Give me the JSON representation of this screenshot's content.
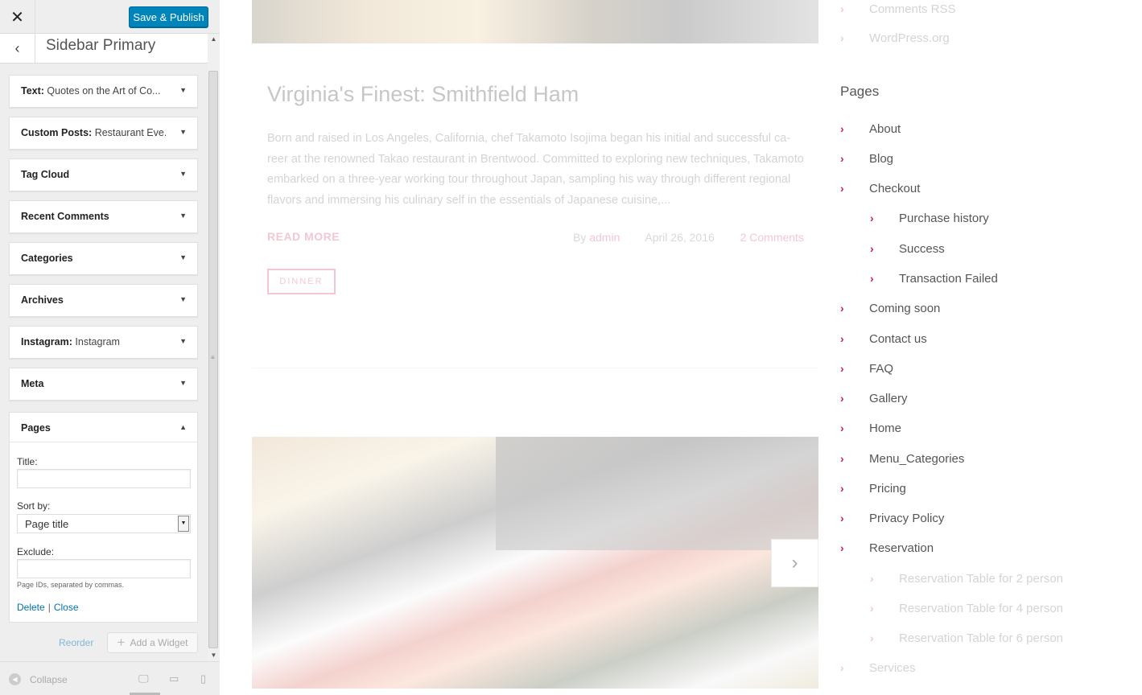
{
  "customizer": {
    "close_icon": "close-icon",
    "publish_label": "Save & Publish",
    "back_icon": "chevron-left-icon",
    "section_title": "Sidebar Primary",
    "widgets": [
      {
        "type": "Text:",
        "name": "Quotes on the Art of Co..."
      },
      {
        "type": "Custom Posts:",
        "name": "Restaurant Eve..."
      },
      {
        "type": "Tag Cloud",
        "name": ""
      },
      {
        "type": "Recent Comments",
        "name": ""
      },
      {
        "type": "Categories",
        "name": ""
      },
      {
        "type": "Archives",
        "name": ""
      },
      {
        "type": "Instagram:",
        "name": "Instagram"
      },
      {
        "type": "Meta",
        "name": ""
      }
    ],
    "pages_widget": {
      "type": "Pages",
      "title_label": "Title:",
      "title_value": "",
      "sort_label": "Sort by:",
      "sort_value": "Page title",
      "exclude_label": "Exclude:",
      "exclude_value": "",
      "help_text": "Page IDs, separated by commas.",
      "delete_label": "Delete",
      "link_sep": "|",
      "close_label": "Close"
    },
    "reorder_label": "Reorder",
    "add_widget_label": "Add a Widget",
    "collapse_label": "Collapse",
    "devices": [
      "desktop-icon",
      "tablet-icon",
      "mobile-icon"
    ],
    "accent_color": "#0085ba"
  },
  "preview": {
    "top_links": [
      "Comments RSS",
      "WordPress.org"
    ],
    "post": {
      "title": "Virginia's Finest: Smithfield Ham",
      "excerpt": "Born and raised in Los Angeles, California, chef Takamoto Isojima began his initial and successful ca-reer at the renowned Takao restaurant in Brentwood. Committed to exploring new techniques, Takamoto embarked on a three-year working tour throughout Japan, sampling his way through different regional flavors and immersing his culinary self in the essentials of Japanese cuisine,...",
      "read_more": "READ MORE",
      "by_label": "By",
      "author": "admin",
      "date": "April 26, 2016",
      "comments": "2 Comments",
      "tag": "DINNER"
    },
    "next_icon": "chevron-right-icon",
    "pages_heading": "Pages",
    "pages": [
      {
        "label": "About",
        "level": 0
      },
      {
        "label": "Blog",
        "level": 0
      },
      {
        "label": "Checkout",
        "level": 0
      },
      {
        "label": "Purchase history",
        "level": 1
      },
      {
        "label": "Success",
        "level": 1
      },
      {
        "label": "Transaction Failed",
        "level": 1
      },
      {
        "label": "Coming soon",
        "level": 0
      },
      {
        "label": "Contact us",
        "level": 0
      },
      {
        "label": "FAQ",
        "level": 0
      },
      {
        "label": "Gallery",
        "level": 0
      },
      {
        "label": "Home",
        "level": 0
      },
      {
        "label": "Menu_Categories",
        "level": 0
      },
      {
        "label": "Pricing",
        "level": 0
      },
      {
        "label": "Privacy Policy",
        "level": 0
      },
      {
        "label": "Reservation",
        "level": 0
      },
      {
        "label": "Reservation Table for 2 person",
        "level": 1
      },
      {
        "label": "Reservation Table for 4 person",
        "level": 1
      },
      {
        "label": "Reservation Table for 6 person",
        "level": 1
      },
      {
        "label": "Services",
        "level": 0
      }
    ],
    "accent_color": "#d21f50"
  }
}
